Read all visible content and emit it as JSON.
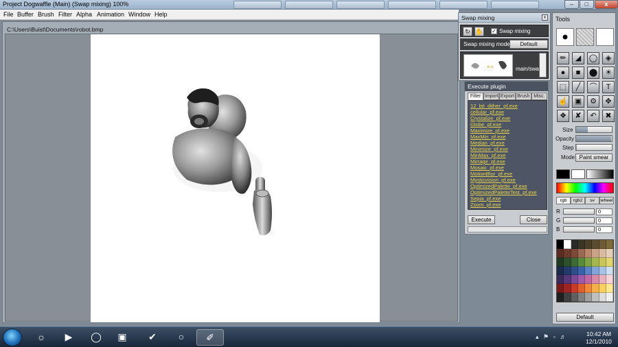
{
  "window": {
    "title": "Project Dogwaffle  (Main)  (Swap mixing)  100%"
  },
  "menu": [
    "File",
    "Buffer",
    "Brush",
    "Filter",
    "Alpha",
    "Animation",
    "Window",
    "Help"
  ],
  "document": {
    "path": "C:\\Users\\Buist\\Documents\\robot.bmp"
  },
  "swap_panel": {
    "title": "Swap mixing",
    "checkbox_label": "Swap mixing",
    "checked": true,
    "mode_label": "Swap mixing mode",
    "mode_value": "Default",
    "preview_label": "main/swap"
  },
  "execute_panel": {
    "title": "Execute plugin",
    "tabs": [
      "Filter",
      "Import",
      "Export",
      "Brush",
      "Misc."
    ],
    "plugins": [
      "12_bit_dither_pf.exe",
      "cellular_pf.exe",
      "Crystalize_pf.exe",
      "Globe_pf.exe",
      "Maximize_pf.exe",
      "MaxMin_pf.exe",
      "Median_pf.exe",
      "Minimize_pf.exe",
      "MinMax_pf.exe",
      "Mirrage_pf.exe",
      "Mosaic_pf.exe",
      "MotionBlur_pf.exe",
      "Mysticvision_pf.exe",
      "OptimizedPalette_pf.exe",
      "OptimizedPaletteTest_pf.exe",
      "Sepia_pf.exe",
      "Zoom_pf.exe"
    ],
    "execute_label": "Execute",
    "close_label": "Close"
  },
  "tools_panel": {
    "title": "Tools",
    "size_label": "Size",
    "opacity_label": "Opacity",
    "step_label": "Step",
    "mode_label": "Mode",
    "mode_value": "Paint smear",
    "size_level": 0.32,
    "opacity_level": 0.98,
    "step_level": 0.02,
    "color_tabs": [
      "rgb",
      "rgb2",
      "sv",
      "wheel"
    ],
    "r_label": "R",
    "g_label": "G",
    "b_label": "B",
    "r_value": "0",
    "g_value": "0",
    "b_value": "0",
    "default_label": "Default",
    "palette": [
      "#000000",
      "#ffffff",
      "#2a2a2a",
      "#3b3526",
      "#4a3f2a",
      "#5b4b2f",
      "#6e5a34",
      "#7f6a3a",
      "#5a2c22",
      "#6b3a2c",
      "#7d4a38",
      "#9a6a52",
      "#b8876c",
      "#cba488",
      "#d8bba0",
      "#e4d0b8",
      "#1f3a22",
      "#2d4f2c",
      "#3e6a35",
      "#5a8a3c",
      "#7ea446",
      "#a5b84f",
      "#c9c55a",
      "#e0d56e",
      "#1a2a4a",
      "#233a6a",
      "#2e4d8a",
      "#3a62a8",
      "#5a82c4",
      "#82a4d8",
      "#a8c2e6",
      "#cfdff2",
      "#3a2a5a",
      "#55377a",
      "#7a4a98",
      "#9c5aa8",
      "#c06aa4",
      "#d88aa8",
      "#e8b0bc",
      "#f4d4d8",
      "#7a1a1a",
      "#a02424",
      "#c83a2a",
      "#e0602e",
      "#ee8a3a",
      "#f4b04a",
      "#f8d060",
      "#fbe890",
      "#202020",
      "#404040",
      "#606060",
      "#808080",
      "#a0a0a0",
      "#c0c0c0",
      "#dcdcdc",
      "#f0f0f0"
    ]
  },
  "taskbar": {
    "time": "10:42 AM",
    "date": "12/1/2010"
  }
}
